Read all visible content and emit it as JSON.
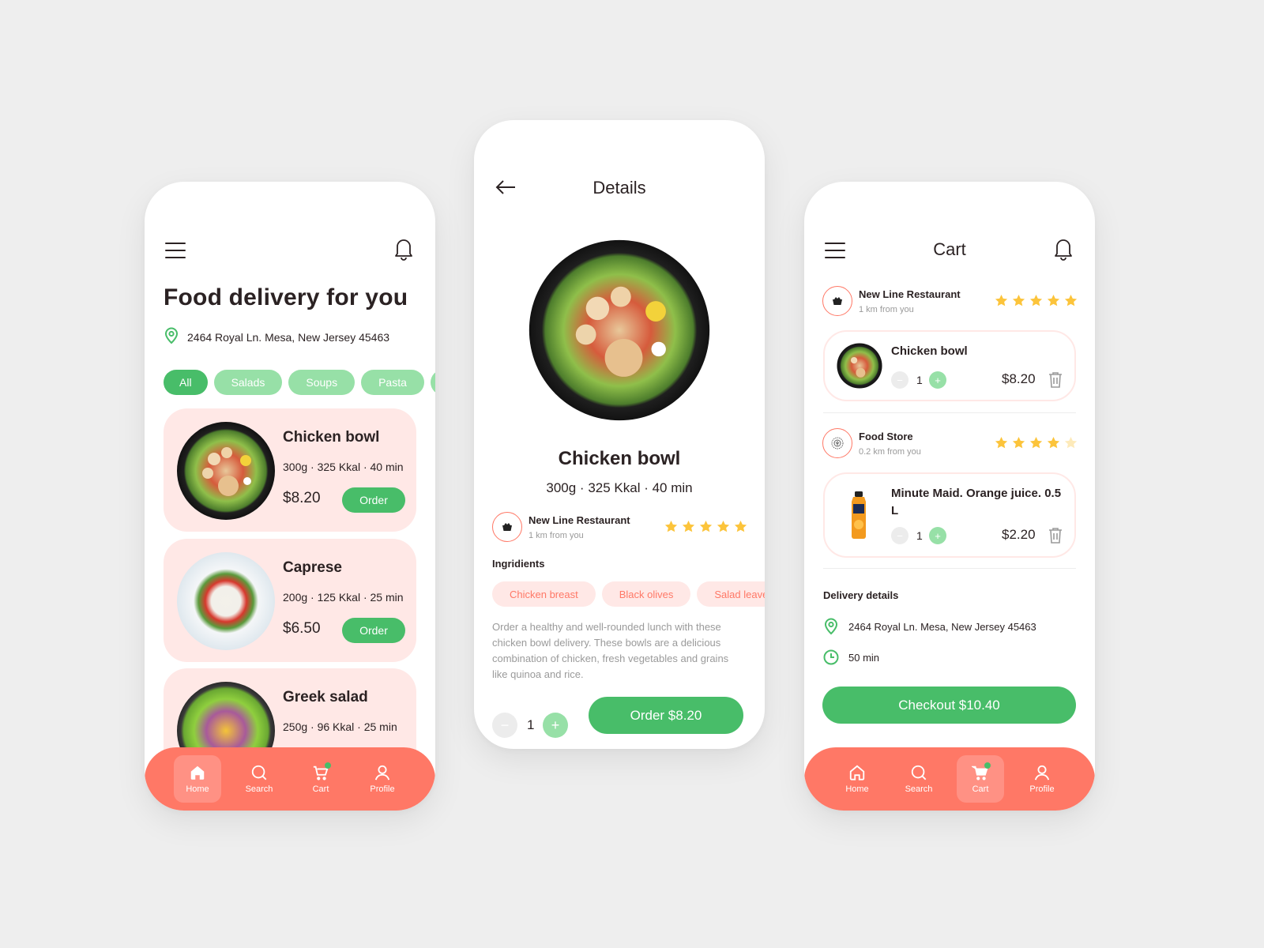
{
  "colors": {
    "background": "#eeeeee",
    "accent_green": "#48bd69",
    "light_green": "#97e0a7",
    "coral": "#ff7866",
    "pink_bg": "#ffe8e6",
    "star": "#fcc43b",
    "text": "#2b2223",
    "muted": "#9a9a9a"
  },
  "home": {
    "menu_icon": "hamburger-icon",
    "notification_icon": "bell-icon",
    "title": "Food delivery for you",
    "address": "2464 Royal Ln. Mesa, New Jersey 45463",
    "categories": [
      {
        "label": "All",
        "active": true
      },
      {
        "label": "Salads",
        "active": false
      },
      {
        "label": "Soups",
        "active": false
      },
      {
        "label": "Pasta",
        "active": false
      },
      {
        "label": "",
        "active": false
      }
    ],
    "items": [
      {
        "name": "Chicken bowl",
        "meta": "300g · 325 Kkal · 40 min",
        "price": "$8.20",
        "button": "Order"
      },
      {
        "name": "Caprese",
        "meta": "200g · 125 Kkal · 25 min",
        "price": "$6.50",
        "button": "Order"
      },
      {
        "name": "Greek salad",
        "meta": "250g · 96 Kkal · 25 min",
        "price": "",
        "button": ""
      }
    ],
    "nav": [
      {
        "label": "Home",
        "icon": "home-icon",
        "active": true
      },
      {
        "label": "Search",
        "icon": "search-icon",
        "active": false
      },
      {
        "label": "Cart",
        "icon": "cart-icon",
        "active": false,
        "badge": true
      },
      {
        "label": "Profile",
        "icon": "profile-icon",
        "active": false
      }
    ]
  },
  "details": {
    "back_icon": "arrow-left-icon",
    "title": "Details",
    "dish_name": "Chicken bowl",
    "dish_meta": "300g · 325 Kkal · 40 min",
    "restaurant": {
      "name": "New Line Restaurant",
      "distance": "1 km from you",
      "rating": 5,
      "max_rating": 5
    },
    "ingredients_label": "Ingridients",
    "ingredients": [
      "Chicken breast",
      "Black olives",
      "Salad leaves"
    ],
    "description": "Order a healthy and well-rounded lunch with these chicken bowl delivery. These bowls are a delicious combination of chicken, fresh vegetables and grains like quinoa and rice.",
    "quantity": "1",
    "minus_label": "−",
    "plus_label": "+",
    "order_button": "Order  $8.20"
  },
  "cart": {
    "title": "Cart",
    "stores": [
      {
        "name": "New Line Restaurant",
        "distance": "1 km from you",
        "rating": 5,
        "max_rating": 5,
        "item": {
          "name": "Chicken bowl",
          "quantity": "1",
          "price": "$8.20"
        }
      },
      {
        "name": "Food Store",
        "distance": "0.2 km from you",
        "rating": 4.5,
        "max_rating": 5,
        "item": {
          "name": "Minute Maid. Orange juice. 0.5 L",
          "quantity": "1",
          "price": "$2.20"
        }
      }
    ],
    "delivery_label": "Delivery details",
    "delivery_address": "2464 Royal Ln. Mesa, New Jersey 45463",
    "delivery_time": "50 min",
    "checkout_button": "Checkout  $10.40",
    "nav": [
      {
        "label": "Home",
        "icon": "home-icon",
        "active": false
      },
      {
        "label": "Search",
        "icon": "search-icon",
        "active": false
      },
      {
        "label": "Cart",
        "icon": "cart-icon",
        "active": true,
        "badge": true
      },
      {
        "label": "Profile",
        "icon": "profile-icon",
        "active": false
      }
    ]
  }
}
